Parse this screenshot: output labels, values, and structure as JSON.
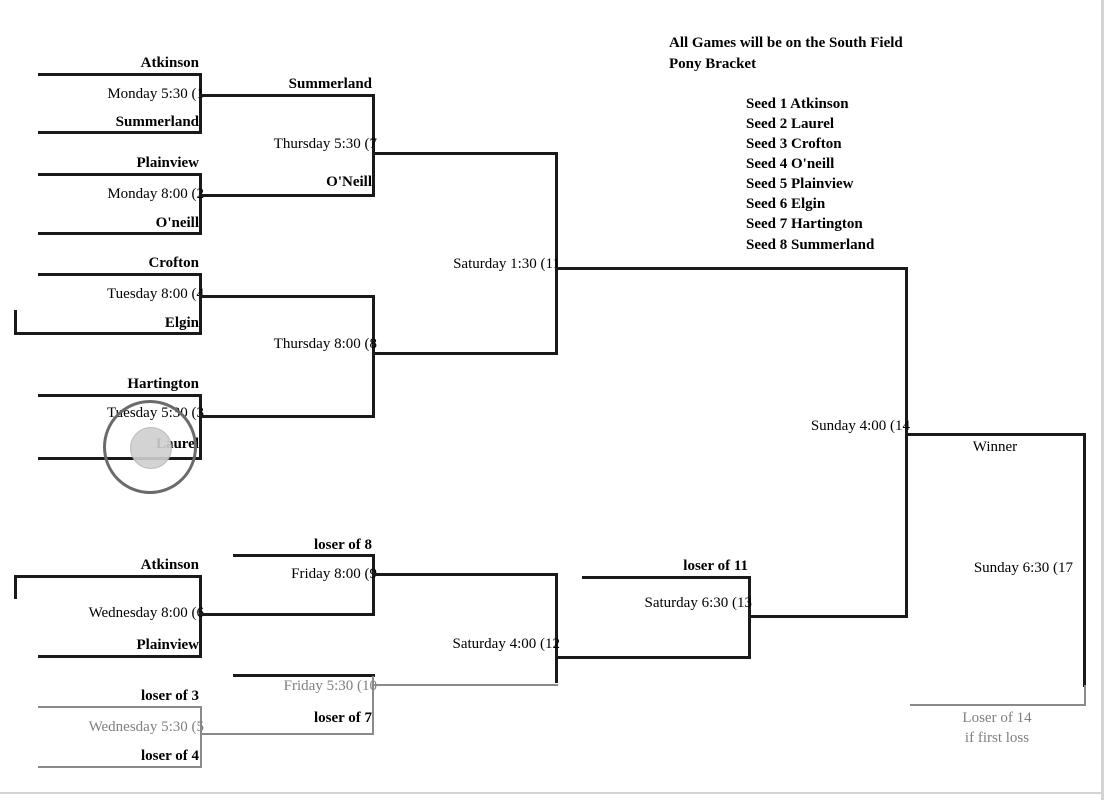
{
  "page": {
    "title": "Pony Bracket",
    "notes": [
      "All Games will be on the South Field",
      "Pony Bracket"
    ],
    "seeds": [
      "Seed 1 Atkinson",
      "Seed 2 Laurel",
      "Seed 3 Crofton",
      "Seed 4 O'neill",
      "Seed 5 Plainview",
      "Seed 6 Elgin",
      "Seed 7 Hartington",
      "Seed 8 Summerland"
    ]
  },
  "colors": {
    "line": "#1a1a1a",
    "line_gray": "#8a8a8a",
    "text": "#000000",
    "text_gray": "#808080",
    "cursor_ring": "#6b6b6b",
    "cursor_fill": "#cfcfcf"
  },
  "winners_bracket": {
    "game1": {
      "top": "Atkinson",
      "bottom": "Summerland",
      "time": "Monday 5:30  (1"
    },
    "game2": {
      "top": "Plainview",
      "bottom": "O'neill",
      "time": "Monday 8:00  (2"
    },
    "game4": {
      "top": "Crofton",
      "bottom": "Elgin",
      "time": "Tuesday 8:00  (4"
    },
    "game3": {
      "top": "Hartington",
      "bottom": "Laurel",
      "time": "Tuesday 5:30   (3"
    },
    "game7": {
      "top": "Summerland",
      "bottom": "O'Neill",
      "time": "Thursday 5:30  (7"
    },
    "game8": {
      "top": "",
      "bottom": "",
      "time": "Thursday 8:00  (8"
    },
    "game11": {
      "top": "",
      "bottom": "",
      "time": "Saturday 1:30  (11"
    },
    "game14": {
      "top": "",
      "bottom": "",
      "time": "Sunday 4:00  (14"
    }
  },
  "losers_bracket": {
    "game6": {
      "top": "Atkinson",
      "bottom": "Plainview",
      "time": "Wednesday 8:00  (6"
    },
    "game5": {
      "top": "loser of 3",
      "bottom": "loser of 4",
      "time": "Wednesday 5:30  (5"
    },
    "game9": {
      "top": "loser of 8",
      "bottom": "",
      "time": "Friday 8:00  (9"
    },
    "game10": {
      "top": "",
      "bottom": "loser of 7",
      "time": "Friday 5:30   (10"
    },
    "game12": {
      "top": "",
      "bottom": "",
      "time": "Saturday 4:00        (12"
    },
    "game13": {
      "top": "loser of 11",
      "bottom": "",
      "time": "Saturday 6:30 (13"
    }
  },
  "final": {
    "winner_label": "Winner",
    "time": "Sunday 6:30  (17",
    "loser_note_line1": "Loser of 14",
    "loser_note_line2": "if first loss"
  },
  "cursor": {
    "target_label": "Laurel"
  }
}
